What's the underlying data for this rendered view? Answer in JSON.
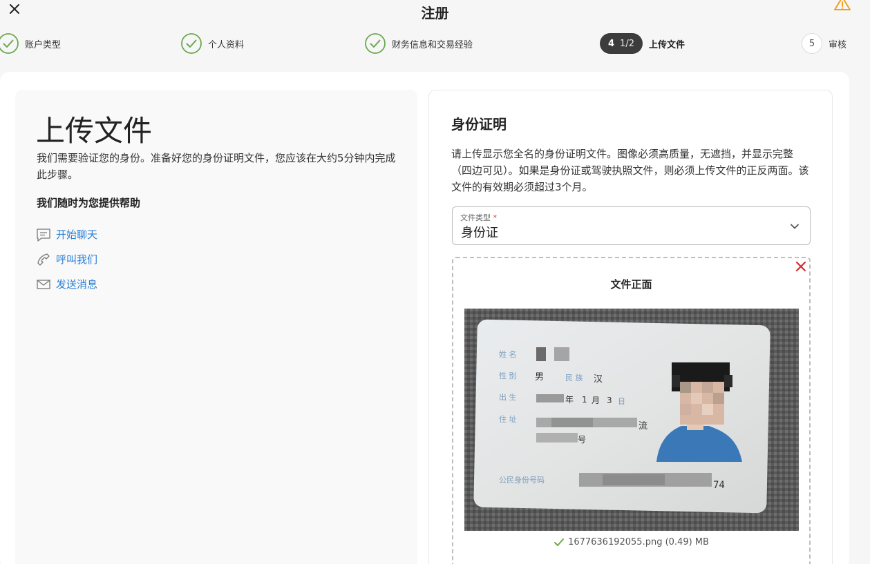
{
  "header": {
    "title": "注册"
  },
  "steps": [
    {
      "label": "账户类型",
      "status": "done"
    },
    {
      "label": "个人资料",
      "status": "done"
    },
    {
      "label": "财务信息和交易经验",
      "status": "done"
    },
    {
      "number": "4",
      "sub": "1/2",
      "label": "上传文件",
      "status": "active"
    },
    {
      "number": "5",
      "label": "审核",
      "status": "todo"
    }
  ],
  "left": {
    "title": "上传文件",
    "description": "我们需要验证您的身份。准备好您的身份证明文件，您应该在大约5分钟内完成此步骤。",
    "help_title": "我们随时为您提供帮助",
    "links": [
      {
        "label": "开始聊天",
        "icon": "chat-icon"
      },
      {
        "label": "呼叫我们",
        "icon": "phone-icon"
      },
      {
        "label": "发送消息",
        "icon": "mail-icon"
      }
    ]
  },
  "right": {
    "title": "身份证明",
    "description": "请上传显示您全名的身份证明文件。图像必须高质量，无遮挡，并显示完整（四边可见）。如果是身份证或驾驶执照文件，则必须上传文件的正反两面。该文件的有效期必须超过3个月。",
    "doc_type": {
      "label": "文件类型",
      "required_mark": "*",
      "value": "身份证"
    },
    "upload": {
      "title": "文件正面",
      "filename": "1677636192055.png (0.49) MB",
      "card": {
        "name_label": "姓 名",
        "sex_label": "性 别",
        "sex_value": "男",
        "ethnic_label": "民 族",
        "ethnic_value": "汉",
        "birth_label": "出 生",
        "birth_year_suffix": "年",
        "birth_month": "1",
        "birth_month_suffix": "月",
        "birth_day": "3",
        "birth_day_suffix": "日",
        "address_label": "住 址",
        "address_fragment": "流",
        "address_fragment2": "号",
        "id_label": "公民身份号码",
        "id_suffix": "74"
      }
    }
  },
  "colors": {
    "check_green": "#6aa84f",
    "link_blue": "#2a7fd4",
    "warning": "#f0a020",
    "remove_red": "#d62d2d",
    "active_step": "#3c3c3c"
  }
}
